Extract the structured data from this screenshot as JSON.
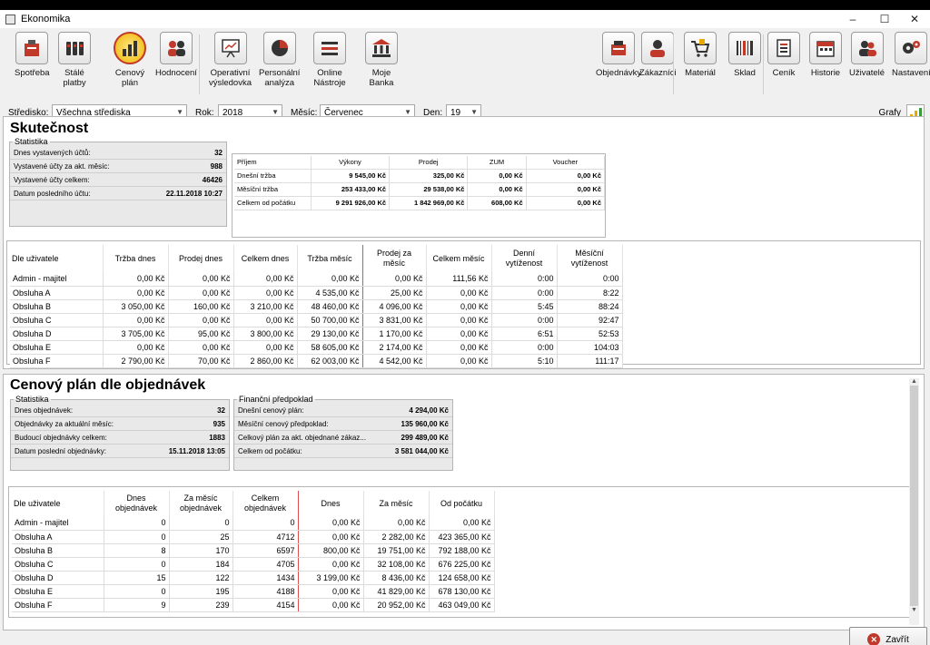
{
  "window": {
    "title": "Ekonomika"
  },
  "toolbar": {
    "left": [
      {
        "label": "Spotřeba",
        "icon": "consumption-icon"
      },
      {
        "label": "Stálé\nplatby",
        "icon": "fixed-payments-icon"
      },
      {
        "label": "Cenový\nplán",
        "icon": "bar-chart-icon",
        "selected": true
      },
      {
        "label": "Hodnocení",
        "icon": "people-rating-icon"
      },
      {
        "label": "Operativní\nvýsledovka",
        "icon": "presentation-icon"
      },
      {
        "label": "Personální\nanalýza",
        "icon": "pie-chart-icon"
      },
      {
        "label": "Online\nNástroje",
        "icon": "menu-lines-icon"
      },
      {
        "label": "Moje\nBanka",
        "icon": "bank-icon"
      }
    ],
    "right": [
      {
        "label": "Objednávky",
        "icon": "orders-icon"
      },
      {
        "label": "Zákazníci",
        "icon": "customers-icon"
      },
      {
        "label": "Materiál",
        "icon": "cart-icon"
      },
      {
        "label": "Sklad",
        "icon": "barcode-icon"
      },
      {
        "label": "Ceník",
        "icon": "price-list-icon"
      },
      {
        "label": "Historie",
        "icon": "calendar-icon"
      },
      {
        "label": "Uživatelé",
        "icon": "users-icon"
      },
      {
        "label": "Nastavení",
        "icon": "gears-icon"
      }
    ]
  },
  "filters": {
    "stredisko_label": "Středisko:",
    "stredisko_value": "Všechna střediska",
    "rok_label": "Rok:",
    "rok_value": "2018",
    "mesic_label": "Měsíc:",
    "mesic_value": "Červenec",
    "den_label": "Den:",
    "den_value": "19",
    "grafy_label": "Grafy"
  },
  "skutecnost": {
    "title": "Skutečnost",
    "stats_legend": "Statistika",
    "stats": [
      {
        "label": "Dnes vystavených účtů:",
        "value": "32"
      },
      {
        "label": "Vystavené účty za akt. měsíc:",
        "value": "988"
      },
      {
        "label": "Vystavené účty celkem:",
        "value": "46426"
      },
      {
        "label": "Datum posledního účtu:",
        "value": "22.11.2018 10:27"
      }
    ],
    "money": {
      "headers": [
        "Příjem",
        "Výkony",
        "Prodej",
        "ZUM",
        "Voucher"
      ],
      "rows": [
        [
          "Dnešní tržba",
          "9 545,00 Kč",
          "325,00 Kč",
          "0,00 Kč",
          "0,00 Kč"
        ],
        [
          "Měsíční tržba",
          "253 433,00 Kč",
          "29 538,00 Kč",
          "0,00 Kč",
          "0,00 Kč"
        ],
        [
          "Celkem od počátku",
          "9 291 926,00 Kč",
          "1 842 969,00 Kč",
          "608,00 Kč",
          "0,00 Kč"
        ]
      ]
    },
    "users": {
      "headers": [
        "Dle uživatele",
        "Tržba dnes",
        "Prodej dnes",
        "Celkem dnes",
        "Tržba měsíc",
        "Prodej za\nměsíc",
        "Celkem měsíc",
        "Denní\nvytíženost",
        "Měsíční\nvytíženost"
      ],
      "rows": [
        [
          "Admin - majitel",
          "0,00 Kč",
          "0,00 Kč",
          "0,00 Kč",
          "0,00 Kč",
          "0,00 Kč",
          "111,56 Kč",
          "0:00",
          "0:00"
        ],
        [
          "Obsluha A",
          "0,00 Kč",
          "0,00 Kč",
          "0,00 Kč",
          "4 535,00 Kč",
          "25,00 Kč",
          "0,00 Kč",
          "0:00",
          "8:22"
        ],
        [
          "Obsluha B",
          "3 050,00 Kč",
          "160,00 Kč",
          "3 210,00 Kč",
          "48 460,00 Kč",
          "4 096,00 Kč",
          "0,00 Kč",
          "5:45",
          "88:24"
        ],
        [
          "Obsluha C",
          "0,00 Kč",
          "0,00 Kč",
          "0,00 Kč",
          "50 700,00 Kč",
          "3 831,00 Kč",
          "0,00 Kč",
          "0:00",
          "92:47"
        ],
        [
          "Obsluha D",
          "3 705,00 Kč",
          "95,00 Kč",
          "3 800,00 Kč",
          "29 130,00 Kč",
          "1 170,00 Kč",
          "0,00 Kč",
          "6:51",
          "52:53"
        ],
        [
          "Obsluha E",
          "0,00 Kč",
          "0,00 Kč",
          "0,00 Kč",
          "58 605,00 Kč",
          "2 174,00 Kč",
          "0,00 Kč",
          "0:00",
          "104:03"
        ],
        [
          "Obsluha F",
          "2 790,00 Kč",
          "70,00 Kč",
          "2 860,00 Kč",
          "62 003,00 Kč",
          "4 542,00 Kč",
          "0,00 Kč",
          "5:10",
          "111:17"
        ]
      ]
    }
  },
  "cenovy": {
    "title": "Cenový plán dle objednávek",
    "stats_legend": "Statistika",
    "stats": [
      {
        "label": "Dnes objednávek:",
        "value": "32"
      },
      {
        "label": "Objednávky za aktuální měsíc:",
        "value": "935"
      },
      {
        "label": "Budoucí objednávky celkem:",
        "value": "1883"
      },
      {
        "label": "Datum poslední objednávky:",
        "value": "15.11.2018 13:05"
      }
    ],
    "fin_legend": "Finanční předpoklad",
    "fin": [
      {
        "label": "Dnešní cenový plán:",
        "value": "4 294,00 Kč"
      },
      {
        "label": "Měsíční cenový předpoklad:",
        "value": "135 960,00 Kč"
      },
      {
        "label": "Celkový plán za akt. objednané zákaz...",
        "value": "299 489,00 Kč"
      },
      {
        "label": "Celkem od počátku:",
        "value": "3 581 044,00 Kč"
      }
    ],
    "users": {
      "headers": [
        "Dle uživatele",
        "Dnes\nobjednávek",
        "Za měsíc\nobjednávek",
        "Celkem\nobjednávek",
        "Dnes",
        "Za měsíc",
        "Od počátku"
      ],
      "rows": [
        [
          "Admin - majitel",
          "0",
          "0",
          "0",
          "0,00 Kč",
          "0,00 Kč",
          "0,00 Kč"
        ],
        [
          "Obsluha A",
          "0",
          "25",
          "4712",
          "0,00 Kč",
          "2 282,00 Kč",
          "423 365,00 Kč"
        ],
        [
          "Obsluha B",
          "8",
          "170",
          "6597",
          "800,00 Kč",
          "19 751,00 Kč",
          "792 188,00 Kč"
        ],
        [
          "Obsluha C",
          "0",
          "184",
          "4705",
          "0,00 Kč",
          "32 108,00 Kč",
          "676 225,00 Kč"
        ],
        [
          "Obsluha D",
          "15",
          "122",
          "1434",
          "3 199,00 Kč",
          "8 436,00 Kč",
          "124 658,00 Kč"
        ],
        [
          "Obsluha E",
          "0",
          "195",
          "4188",
          "0,00 Kč",
          "41 829,00 Kč",
          "678 130,00 Kč"
        ],
        [
          "Obsluha F",
          "9",
          "239",
          "4154",
          "0,00 Kč",
          "20 952,00 Kč",
          "463 049,00 Kč"
        ]
      ]
    }
  },
  "footer": {
    "close_label": "Zavřít"
  }
}
